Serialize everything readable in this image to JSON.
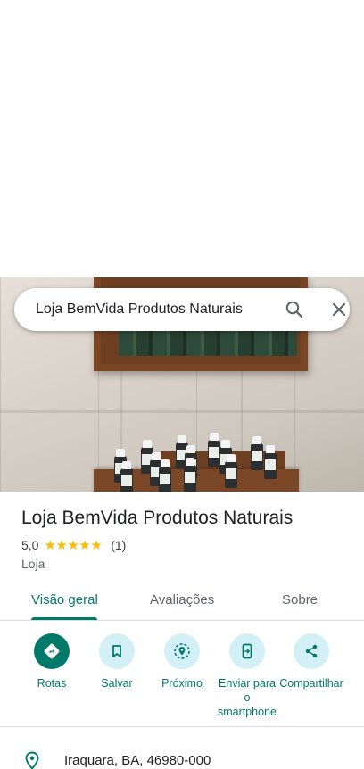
{
  "search": {
    "query": "Loja BemVida Produtos Naturais"
  },
  "place": {
    "title": "Loja BemVida Produtos Naturais",
    "rating": "5,0",
    "stars": "★★★★★",
    "review_count": "(1)",
    "category": "Loja"
  },
  "tabs": [
    {
      "label": "Visão geral",
      "active": true
    },
    {
      "label": "Avaliações",
      "active": false
    },
    {
      "label": "Sobre",
      "active": false
    }
  ],
  "actions": [
    {
      "label": "Rotas",
      "icon": "directions-icon"
    },
    {
      "label": "Salvar",
      "icon": "bookmark-icon"
    },
    {
      "label": "Próximo",
      "icon": "nearby-icon"
    },
    {
      "label": "Enviar para o smartphone",
      "icon": "send-to-phone-icon"
    },
    {
      "label": "Compartilhar",
      "icon": "share-icon"
    }
  ],
  "address": {
    "text": "Iraquara, BA, 46980-000",
    "icon": "location-pin-icon"
  },
  "colors": {
    "accent": "#00796b",
    "action_bg": "#d2f0f5",
    "star": "#fbbc04"
  }
}
